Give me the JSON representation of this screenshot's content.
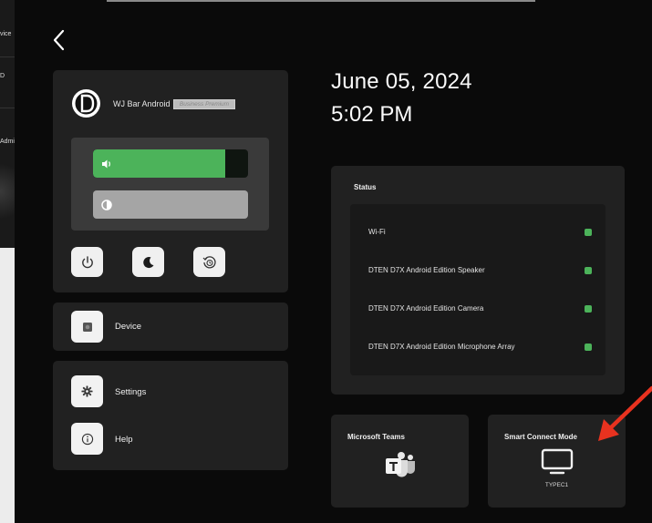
{
  "left_strip": {
    "labels": [
      "vice",
      "D",
      "Admi"
    ]
  },
  "device": {
    "name": "WJ Bar Android",
    "badge": "Business Premium",
    "volume_level": 0.85,
    "brightness_level": 1.0
  },
  "actions": [
    {
      "name": "power-button",
      "icon": "power-icon"
    },
    {
      "name": "sleep-button",
      "icon": "moon-icon"
    },
    {
      "name": "restart-button",
      "icon": "restart-icon"
    }
  ],
  "menu": {
    "device_label": "Device",
    "settings_label": "Settings",
    "help_label": "Help"
  },
  "datetime": {
    "date": "June 05, 2024",
    "time": "5:02 PM"
  },
  "status": {
    "title": "Status",
    "items": [
      {
        "label": "Wi-Fi",
        "state": "ok"
      },
      {
        "label": "DTEN D7X Android Edition Speaker",
        "state": "ok"
      },
      {
        "label": "DTEN D7X Android Edition Camera",
        "state": "ok"
      },
      {
        "label": "DTEN D7X Android Edition Microphone Array",
        "state": "ok"
      }
    ],
    "ok_color": "#4cb35a"
  },
  "modes": {
    "teams": {
      "title": "Microsoft Teams",
      "icon": "teams-icon"
    },
    "smart": {
      "title": "Smart Connect Mode",
      "subtitle": "TYPEC1",
      "icon": "monitor-icon"
    }
  },
  "colors": {
    "accent_green": "#4cb35a",
    "annotation_red": "#e8321f"
  }
}
